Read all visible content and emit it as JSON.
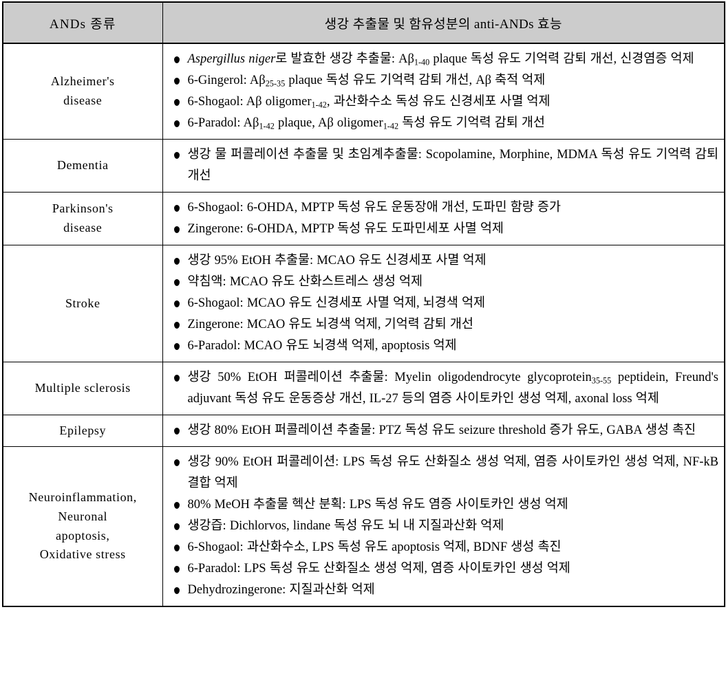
{
  "table": {
    "columns": [
      {
        "key": "type",
        "header": "ANDs 종류"
      },
      {
        "key": "effect",
        "header": "생강 추출물 및 함유성분의 anti-ANDs 효능"
      }
    ],
    "header_bg": "#cccccc",
    "border_color": "#000000",
    "rows": [
      {
        "category_lines": [
          "Alzheimer's",
          "disease"
        ],
        "bullets": [
          {
            "html": "<span class=\"it\">Aspergillus niger</span>로 발효한 생강 추출물: Aβ<sub>1-40</sub> plaque 독성 유도 기억력 감퇴 개선, 신경염증 억제",
            "text": "Aspergillus niger로 발효한 생강 추출물: Aβ1-40 plaque 독성 유도 기억력 감퇴 개선, 신경염증 억제"
          },
          {
            "html": "6-Gingerol: Aβ<sub>25-35</sub> plaque 독성 유도 기억력 감퇴 개선, Aβ 축적 억제",
            "text": "6-Gingerol: Aβ25-35 plaque 독성 유도 기억력 감퇴 개선, Aβ 축적 억제"
          },
          {
            "html": "6-Shogaol: Aβ oligomer<sub>1-42</sub>, 과산화수소 독성 유도 신경세포 사멸 억제",
            "text": "6-Shogaol: Aβ oligomer1-42, 과산화수소 독성 유도 신경세포 사멸 억제"
          },
          {
            "html": "6-Paradol: Aβ<sub>1-42</sub> plaque, Aβ oligomer<sub>1-42</sub> 독성 유도 기억력 감퇴 개선",
            "text": "6-Paradol: Aβ1-42 plaque, Aβ oligomer1-42 독성 유도 기억력 감퇴 개선"
          }
        ]
      },
      {
        "category_lines": [
          "Dementia"
        ],
        "bullets": [
          {
            "html": "생강 물 퍼콜레이션 추출물 및 초임계추출물: Scopolamine, Morphine, MDMA 독성 유도 기억력 감퇴 개선",
            "text": "생강 물 퍼콜레이션 추출물 및 초임계추출물: Scopolamine, Morphine, MDMA 독성 유도 기억력 감퇴 개선"
          }
        ]
      },
      {
        "category_lines": [
          "Parkinson's",
          "disease"
        ],
        "bullets": [
          {
            "html": "6-Shogaol: 6-OHDA, MPTP 독성 유도 운동장애 개선, 도파민 함량 증가",
            "text": "6-Shogaol: 6-OHDA, MPTP 독성 유도 운동장애 개선, 도파민 함량 증가"
          },
          {
            "html": "Zingerone: 6-OHDA, MPTP 독성 유도 도파민세포 사멸 억제",
            "text": "Zingerone: 6-OHDA, MPTP 독성 유도 도파민세포 사멸 억제"
          }
        ]
      },
      {
        "category_lines": [
          "Stroke"
        ],
        "bullets": [
          {
            "html": "생강 95% EtOH 추출물: MCAO 유도 신경세포 사멸 억제",
            "text": "생강 95% EtOH 추출물: MCAO 유도 신경세포 사멸 억제"
          },
          {
            "html": "약침액: MCAO 유도 산화스트레스 생성 억제",
            "text": "약침액: MCAO 유도 산화스트레스 생성 억제"
          },
          {
            "html": "6-Shogaol: MCAO 유도 신경세포 사멸 억제, 뇌경색 억제",
            "text": "6-Shogaol: MCAO 유도 신경세포 사멸 억제, 뇌경색 억제"
          },
          {
            "html": "Zingerone: MCAO 유도 뇌경색 억제, 기억력 감퇴 개선",
            "text": "Zingerone: MCAO 유도 뇌경색 억제, 기억력 감퇴 개선"
          },
          {
            "html": "6-Paradol: MCAO 유도 뇌경색 억제, apoptosis 억제",
            "text": "6-Paradol: MCAO 유도 뇌경색 억제, apoptosis 억제"
          }
        ]
      },
      {
        "category_lines": [
          "Multiple sclerosis"
        ],
        "bullets": [
          {
            "html": "생강 50% EtOH 퍼콜레이션 추출물: Myelin oligodendrocyte glycoprotein<sub>35-55</sub> peptidein, Freund's adjuvant 독성 유도 운동증상 개선, IL-27 등의 염증 사이토카인 생성 억제, axonal loss 억제",
            "text": "생강 50% EtOH 퍼콜레이션 추출물: Myelin oligodendrocyte glycoprotein35-55 peptidein, Freund's adjuvant 독성 유도 운동증상 개선, IL-27 등의 염증 사이토카인 생성 억제, axonal loss 억제"
          }
        ]
      },
      {
        "category_lines": [
          "Epilepsy"
        ],
        "bullets": [
          {
            "html": "생강 80% EtOH 퍼콜레이션 추출물: PTZ 독성 유도 seizure threshold 증가 유도, GABA 생성 촉진",
            "text": "생강 80% EtOH 퍼콜레이션 추출물: PTZ 독성 유도 seizure threshold 증가 유도, GABA 생성 촉진"
          }
        ]
      },
      {
        "category_lines": [
          "Neuroinflammation,",
          "Neuronal",
          "apoptosis,",
          "Oxidative stress"
        ],
        "bullets": [
          {
            "html": "생강 90% EtOH 퍼콜레이션: LPS 독성 유도 산화질소 생성 억제, 염증 사이토카인 생성 억제, NF-kB 결합 억제",
            "text": "생강 90% EtOH 퍼콜레이션: LPS 독성 유도 산화질소 생성 억제, 염증 사이토카인 생성 억제, NF-kB 결합 억제"
          },
          {
            "html": "80% MeOH 추출물 헥산 분획: LPS 독성 유도 염증 사이토카인 생성 억제",
            "text": "80% MeOH 추출물 헥산 분획: LPS 독성 유도 염증 사이토카인 생성 억제"
          },
          {
            "html": "생강즙: Dichlorvos, lindane 독성 유도 뇌 내 지질과산화 억제",
            "text": "생강즙: Dichlorvos, lindane 독성 유도 뇌 내 지질과산화 억제"
          },
          {
            "html": "6-Shogaol: 과산화수소, LPS 독성 유도 apoptosis 억제, BDNF 생성 촉진",
            "text": "6-Shogaol: 과산화수소, LPS 독성 유도 apoptosis 억제, BDNF 생성 촉진"
          },
          {
            "html": "6-Paradol: LPS 독성 유도 산화질소 생성 억제, 염증 사이토카인 생성 억제",
            "text": "6-Paradol: LPS 독성 유도 산화질소 생성 억제, 염증 사이토카인 생성 억제"
          },
          {
            "html": "Dehydrozingerone: 지질과산화 억제",
            "text": "Dehydrozingerone: 지질과산화 억제"
          }
        ]
      }
    ]
  }
}
